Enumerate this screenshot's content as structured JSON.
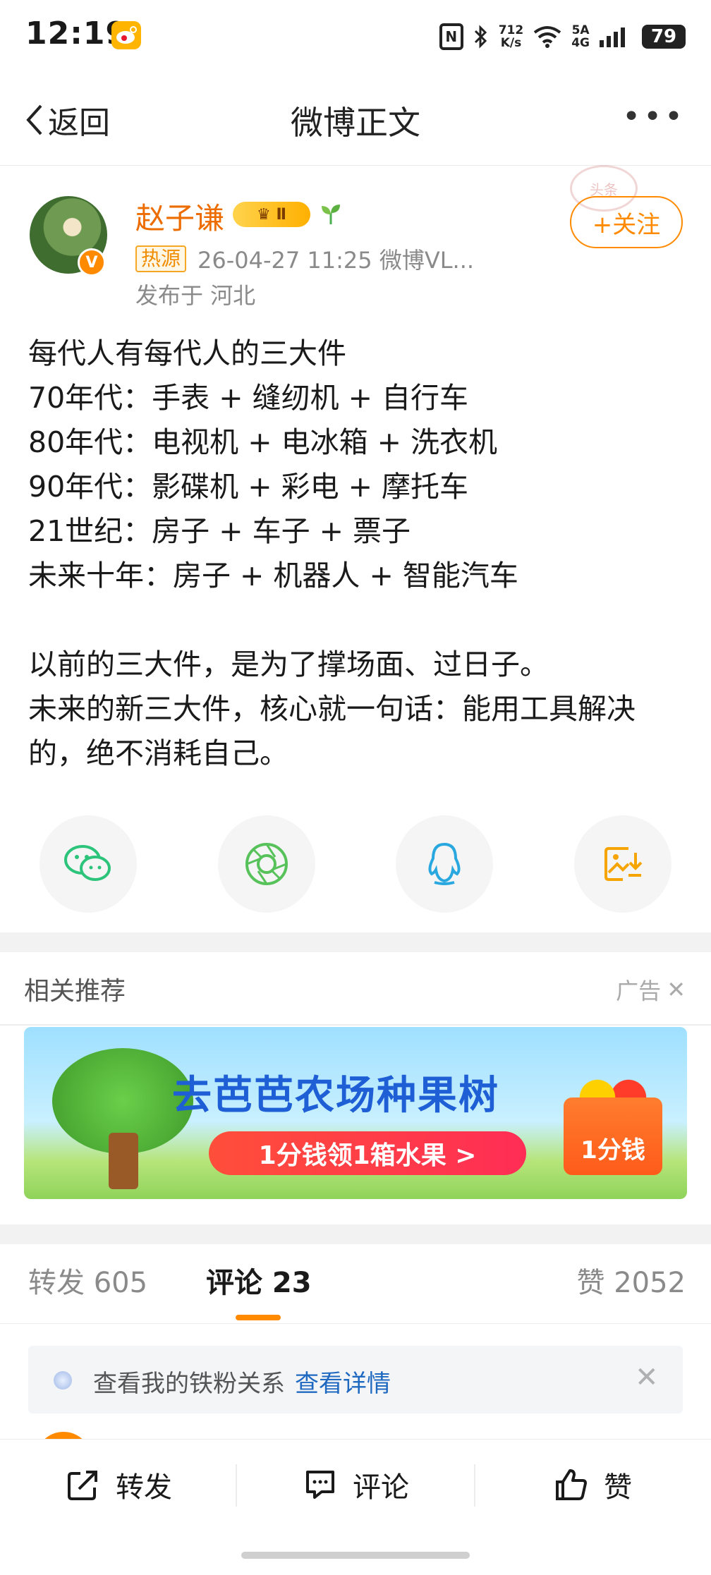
{
  "status_bar": {
    "time": "12:19",
    "net_speed_top": "712",
    "net_speed_bottom": "K/s",
    "signal_top": "5A",
    "signal_bottom": "4G",
    "battery": "79"
  },
  "header": {
    "back_label": "返回",
    "title": "微博正文"
  },
  "post": {
    "author_name": "赵子谦",
    "level_badge": "Ⅱ",
    "hot_tag": "热源",
    "meta": "26-04-27 11:25  微博VL...",
    "location": "发布于 河北",
    "follow_label": "+关注",
    "stamp_text": "头条",
    "body": "每代人有每代人的三大件\n70年代：手表 + 缝纫机 + 自行车\n80年代：电视机 + 电冰箱 + 洗衣机\n90年代：影碟机 + 彩电 + 摩托车\n21世纪：房子 + 车子 + 票子\n未来十年：房子 + 机器人 + 智能汽车\n\n以前的三大件，是为了撑场面、过日子。\n未来的新三大件，核心就一句话：能用工具解决的，绝不消耗自己。"
  },
  "recommend": {
    "title": "相关推荐",
    "ad_label": "广告",
    "ad_headline": "去芭芭农场种果树",
    "ad_button": "1分钱领1箱水果 >",
    "ad_box_text": "1分钱"
  },
  "tabs": {
    "repost": "转发 605",
    "comment": "评论 23",
    "like": "赞 2052"
  },
  "fan_notice": {
    "text": "查看我的铁粉关系",
    "link": "查看详情"
  },
  "bottom_bar": {
    "repost": "转发",
    "comment": "评论",
    "like": "赞"
  },
  "colors": {
    "accent": "#ff8a00",
    "author_name": "#ec6c00",
    "link": "#1f69c0"
  }
}
